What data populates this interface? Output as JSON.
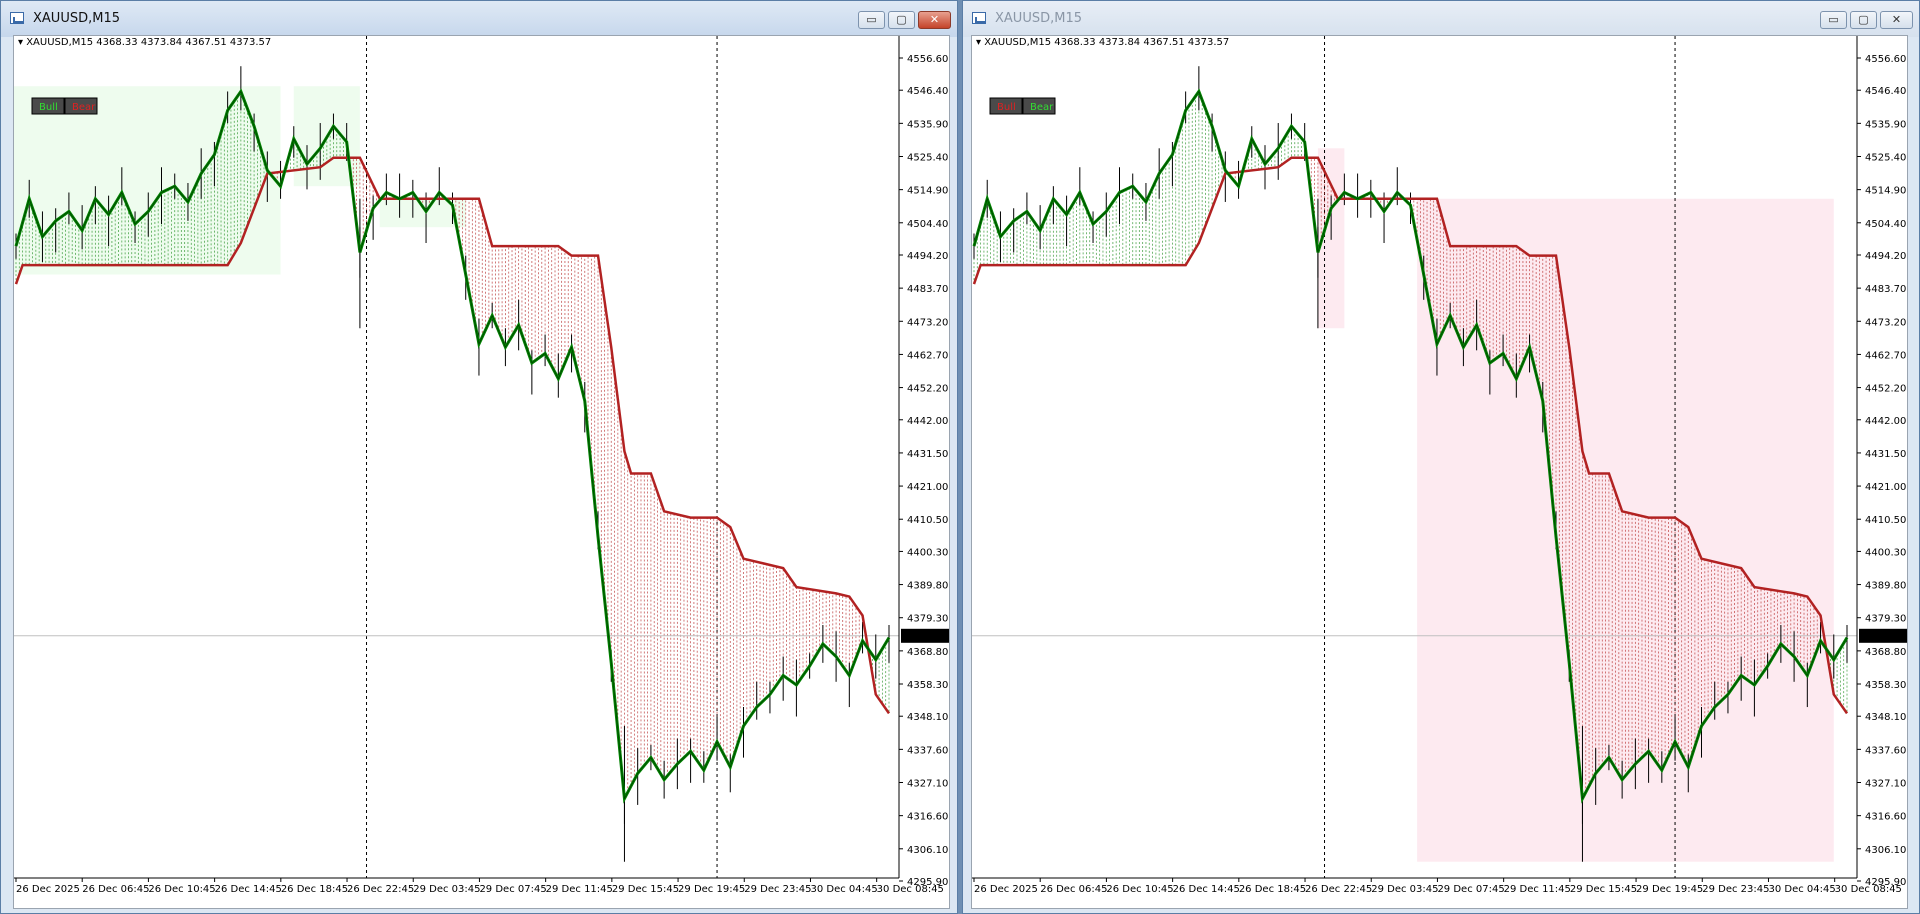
{
  "windows": [
    {
      "title": "XAUUSD,M15",
      "symbol_line": "XAUUSD,M15  4368.33 4373.84 4367.51 4373.57",
      "buttons": [
        {
          "label": "Bull",
          "color": "#33dd33"
        },
        {
          "label": "Bear",
          "color": "#dd2222"
        }
      ],
      "active": true
    },
    {
      "title": "XAUUSD,M15",
      "symbol_line": "XAUUSD,M15  4368.33 4373.84 4367.51 4373.57",
      "buttons": [
        {
          "label": "Bull",
          "color": "#dd2222"
        },
        {
          "label": "Bear",
          "color": "#33dd33"
        }
      ],
      "active": false
    }
  ],
  "controls": {
    "minimize": "▭",
    "maximize": "▢",
    "close": "✕"
  },
  "chart_data": {
    "type": "line",
    "symbol": "XAUUSD",
    "timeframe": "M15",
    "ohlc": {
      "open": 4368.33,
      "high": 4373.84,
      "low": 4367.51,
      "close": 4373.57
    },
    "current_price_label": "4373.57",
    "y_ticks": [
      "4556.60",
      "4546.40",
      "4535.90",
      "4525.40",
      "4514.90",
      "4504.40",
      "4494.20",
      "4483.70",
      "4473.20",
      "4462.70",
      "4452.20",
      "4442.00",
      "4431.50",
      "4421.00",
      "4410.50",
      "4400.30",
      "4389.80",
      "4379.30",
      "4368.80",
      "4358.30",
      "4348.10",
      "4337.60",
      "4327.10",
      "4316.60",
      "4306.10",
      "4295.90"
    ],
    "x_ticks": [
      "26 Dec 2025",
      "26 Dec 06:45",
      "26 Dec 10:45",
      "26 Dec 14:45",
      "26 Dec 18:45",
      "26 Dec 22:45",
      "29 Dec 03:45",
      "29 Dec 07:45",
      "29 Dec 11:45",
      "29 Dec 15:45",
      "29 Dec 19:45",
      "29 Dec 23:45",
      "30 Dec 04:45",
      "30 Dec 08:45"
    ],
    "ylim": [
      4295.9,
      4556.6
    ],
    "series": [
      {
        "name": "price",
        "color": "#008000",
        "points": [
          [
            0,
            4497
          ],
          [
            2,
            4512
          ],
          [
            4,
            4500
          ],
          [
            6,
            4505
          ],
          [
            8,
            4508
          ],
          [
            10,
            4502
          ],
          [
            12,
            4512
          ],
          [
            14,
            4507
          ],
          [
            16,
            4514
          ],
          [
            18,
            4504
          ],
          [
            20,
            4508
          ],
          [
            22,
            4514
          ],
          [
            24,
            4516
          ],
          [
            26,
            4511
          ],
          [
            28,
            4520
          ],
          [
            30,
            4526
          ],
          [
            32,
            4540
          ],
          [
            34,
            4546
          ],
          [
            36,
            4535
          ],
          [
            38,
            4521
          ],
          [
            40,
            4516
          ],
          [
            42,
            4531
          ],
          [
            44,
            4523
          ],
          [
            46,
            4528
          ],
          [
            48,
            4535
          ],
          [
            50,
            4530
          ],
          [
            52,
            4495
          ],
          [
            54,
            4509
          ],
          [
            56,
            4514
          ],
          [
            58,
            4512
          ],
          [
            60,
            4514
          ],
          [
            62,
            4508
          ],
          [
            64,
            4514
          ],
          [
            66,
            4510
          ],
          [
            68,
            4488
          ],
          [
            70,
            4466
          ],
          [
            72,
            4475
          ],
          [
            74,
            4465
          ],
          [
            76,
            4472
          ],
          [
            78,
            4460
          ],
          [
            80,
            4463
          ],
          [
            82,
            4455
          ],
          [
            84,
            4465
          ],
          [
            86,
            4448
          ],
          [
            88,
            4405
          ],
          [
            90,
            4365
          ],
          [
            92,
            4322
          ],
          [
            94,
            4330
          ],
          [
            96,
            4335
          ],
          [
            98,
            4328
          ],
          [
            100,
            4333
          ],
          [
            102,
            4337
          ],
          [
            104,
            4331
          ],
          [
            106,
            4340
          ],
          [
            108,
            4332
          ],
          [
            110,
            4345
          ],
          [
            112,
            4351
          ],
          [
            114,
            4355
          ],
          [
            116,
            4361
          ],
          [
            118,
            4358
          ],
          [
            120,
            4364
          ],
          [
            122,
            4371
          ],
          [
            124,
            4367
          ],
          [
            126,
            4361
          ],
          [
            128,
            4372
          ],
          [
            130,
            4366
          ],
          [
            132,
            4373
          ]
        ]
      },
      {
        "name": "trailing",
        "color": "#b22222",
        "points": [
          [
            0,
            4485
          ],
          [
            1,
            4491
          ],
          [
            32,
            4491
          ],
          [
            34,
            4498
          ],
          [
            36,
            4509
          ],
          [
            38,
            4520
          ],
          [
            46,
            4522
          ],
          [
            48,
            4525
          ],
          [
            52,
            4525
          ],
          [
            55,
            4512
          ],
          [
            70,
            4512
          ],
          [
            72,
            4497
          ],
          [
            82,
            4497
          ],
          [
            84,
            4494
          ],
          [
            88,
            4494
          ],
          [
            90,
            4465
          ],
          [
            92,
            4432
          ],
          [
            93,
            4425
          ],
          [
            96,
            4425
          ],
          [
            98,
            4413
          ],
          [
            102,
            4411
          ],
          [
            106,
            4411
          ],
          [
            108,
            4408
          ],
          [
            110,
            4398
          ],
          [
            116,
            4395
          ],
          [
            118,
            4389
          ],
          [
            124,
            4387
          ],
          [
            126,
            4386
          ],
          [
            128,
            4380
          ],
          [
            130,
            4355
          ],
          [
            132,
            4349
          ]
        ]
      }
    ]
  }
}
